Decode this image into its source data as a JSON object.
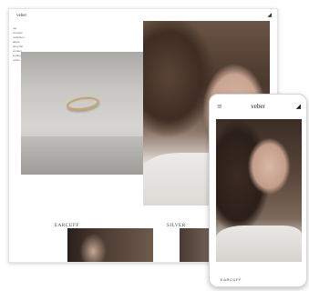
{
  "desktop": {
    "logo": "veber",
    "nav_items": [
      "top",
      "concept",
      "collection",
      "about",
      "shop list",
      "contact",
      "instagram",
      "online shop"
    ],
    "categories": [
      "EARCUFF",
      "SILVER"
    ]
  },
  "phone": {
    "logo": "veber",
    "category": "EARCUFF"
  },
  "icons": {
    "cart": "cart-icon",
    "menu": "hamburger-menu-icon"
  }
}
